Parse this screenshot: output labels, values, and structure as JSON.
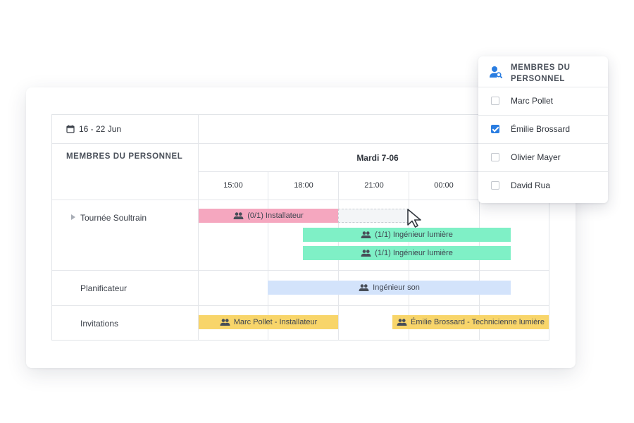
{
  "toolbar": {
    "date_range": "16 - 22 Jun",
    "calendar_icon": "calendar-icon"
  },
  "header": {
    "staff_column_title": "MEMBRES DU PERSONNEL",
    "day_title": "Mardi 7-06",
    "hours": [
      "15:00",
      "18:00",
      "21:00",
      "00:00"
    ]
  },
  "rows": [
    {
      "label": "Tournée Soultrain",
      "expandable": true
    },
    {
      "label": "Planificateur"
    },
    {
      "label": "Invitations"
    }
  ],
  "bars": {
    "installateur_open": "(0/1) Installateur",
    "ingenieur_lumiere_1": "(1/1) Ingénieur lumière",
    "ingenieur_lumiere_2": "(1/1) Ingénieur lumière",
    "ingenieur_son": "Ingénieur son",
    "invitation_1": "Marc Pollet - Installateur",
    "invitation_2": "Émilie Brossard - Technicienne lumière"
  },
  "colors": {
    "pink": "#f5a7bf",
    "green": "#7ff0c6",
    "blue": "#d3e3fb",
    "yellow": "#f8d56a",
    "accent": "#2a7de1"
  },
  "staff_panel": {
    "title": "MEMBRES DU PERSONNEL",
    "icon": "person-search-icon",
    "members": [
      {
        "name": "Marc Pollet",
        "checked": false
      },
      {
        "name": "Émilie Brossard",
        "checked": true
      },
      {
        "name": "Olivier Mayer",
        "checked": false
      },
      {
        "name": "David Rua",
        "checked": false
      }
    ]
  }
}
